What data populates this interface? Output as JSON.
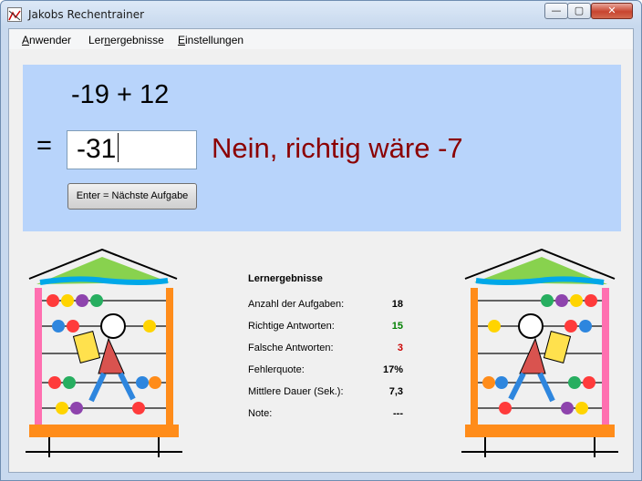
{
  "window": {
    "title": "Jakobs Rechentrainer",
    "controls": {
      "minimize": "—",
      "maximize": "▢",
      "close": "✕"
    }
  },
  "menu": {
    "items": [
      {
        "first": "A",
        "rest": "nwender"
      },
      {
        "first": "Ler",
        "under": "n",
        "rest": "ergebnisse"
      },
      {
        "first": "E",
        "rest": "instellungen"
      }
    ]
  },
  "task": {
    "problem": "-19 + 12",
    "equals": "=",
    "answer": "-31",
    "feedback": "Nein, richtig wäre -7",
    "next_button": "Enter = Nächste Aufgabe"
  },
  "results": {
    "title": "Lernergebnisse",
    "rows": [
      {
        "label": "Anzahl der Aufgaben:",
        "value": "18"
      },
      {
        "label": "Richtige Antworten:",
        "value": "15"
      },
      {
        "label": "Falsche Antworten:",
        "value": "3"
      },
      {
        "label": "Fehlerquote:",
        "value": "17%"
      },
      {
        "label": "Mittlere Dauer (Sek.):",
        "value": "7,3"
      },
      {
        "label": "Note:",
        "value": "---"
      }
    ]
  },
  "colors": {
    "panel": "#b8d4fb",
    "feedback": "#8b0000",
    "correct": "#008000",
    "wrong": "#cc0000"
  },
  "icons": [
    "abacus-illustration-left",
    "abacus-illustration-right",
    "app-icon"
  ]
}
